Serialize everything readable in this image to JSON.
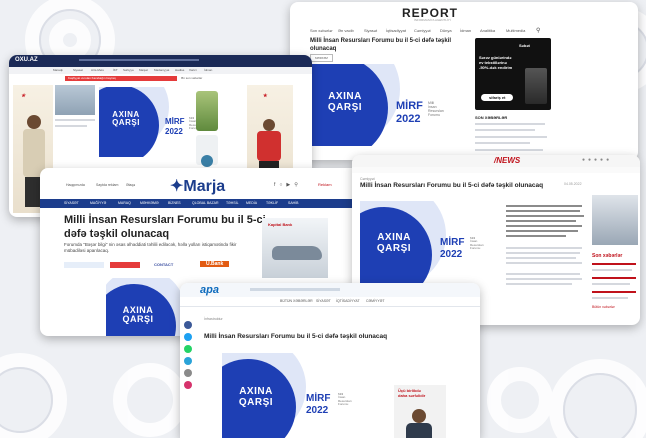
{
  "colors": {
    "banner_blue": "#1e3fb4",
    "oxu_nav": "#1b2a57",
    "marja_nav": "#1c3d8c",
    "apa_blue": "#0e6bbd",
    "news_red": "#c0121b",
    "report_dark": "#222"
  },
  "headline": "Milli İnsan Resursları Forumu bu il 5-ci dəfə təşkil olunacaq",
  "banner": {
    "line1": "AXINA",
    "line2": "QARŞI",
    "event": "MİRF",
    "year": "2022",
    "sub1": "Milli",
    "sub2": "İnsan",
    "sub3": "Resursları",
    "sub4": "Forumu"
  },
  "report": {
    "logo": "REPORT",
    "tagline": "İNFORMASİYA AGENTLİYİ",
    "nav": [
      "Son xəbərlər",
      "Ən vacib",
      "Siyasət",
      "İqtisadiyyat",
      "Cəmiyyət",
      "Dünya",
      "İdman",
      "Analitika",
      "Multimedia"
    ],
    "tag": "MƏRKƏZ",
    "ad_sub": "Səbət",
    "ad_l1": "Sərəv günlərində",
    "ad_l2": "ev tekstillərinə",
    "ad_l3": "-50%-dək endirim",
    "ad_btn": "sifariş et",
    "news_header": "SON XƏBƏRLƏR"
  },
  "oxu": {
    "logo": "OXU.AZ",
    "nav": [
      "Maraqlı",
      "Siyasət",
      "Arts-Mets",
      "İKT",
      "Səhiyyə",
      "Məişət",
      "Mədəniyyət",
      "Hadisə",
      "Xarici",
      "İdman"
    ],
    "strip": "Kəşfiyyat vurulan Karabağın bayraq",
    "strip2": "Ən son xəbərlər"
  },
  "marja": {
    "logo": "Marja",
    "top": [
      "Haqqımızda",
      "Saytda reklam",
      "Əlaqə"
    ],
    "ad_link": "Reklam",
    "nav": [
      "SİYASƏT",
      "MAĞİYYƏ",
      "MARAQ",
      "MƏHKƏMƏ",
      "BİZNES",
      "QLOBAL BAZAR",
      "TƏHSİL",
      "MEDİA",
      "TƏKLİF",
      "SAHİB"
    ],
    "title": "Milli İnsan Resursları Forumu bu il 5-ci dəfə təşkil olunacaq",
    "lead": "Forumda \"Bəşər bilgi\" nin əsas əlhəddiati təhlili ediləcək, həllə yolları istiqamətində fikir mübadiləsi aparılacaq.",
    "ad1": "CONTACT",
    "ad2": "U.Bank",
    "ad3": "Kapital Bank"
  },
  "news": {
    "logo": "/NEWS",
    "tag": "Cəmiyyət",
    "title": "Milli İnsan Resursları Forumu bu il 5-ci dəfə təşkil olunacaq",
    "date": "04.05.2022",
    "sidebar_title": "Son xəbərlər",
    "sidebar_link": "Bütün xəbərlər"
  },
  "apa": {
    "logo": "apa",
    "nav": [
      "BÜTÜN XƏBƏRLƏR",
      "SİYASƏT",
      "İQTİSADİYYAT",
      "CƏMİYYƏT"
    ],
    "breadcrumb": "İnfrastruktur",
    "title": "Milli İnsan Resursları Forumu bu il 5-ci dəfə təşkil olunacaq",
    "ad_l1": "Üçü birlikdə",
    "ad_l2": "daha sərfəlidir"
  }
}
